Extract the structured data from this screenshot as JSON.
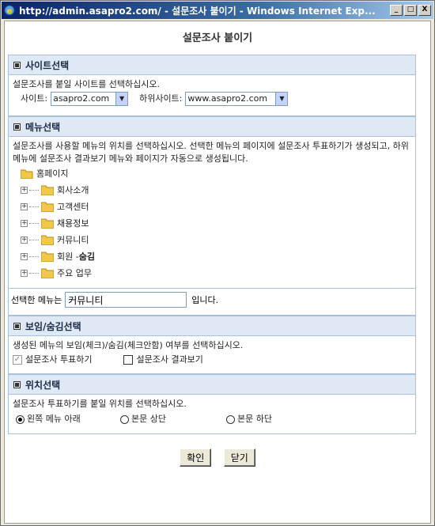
{
  "window": {
    "title": "http://admin.asapro2.com/ - 설문조사 붙이기 - Windows Internet Exp...",
    "minimize": "_",
    "maximize": "□",
    "close": "X"
  },
  "page": {
    "title": "설문조사 붙이기"
  },
  "site_section": {
    "header": "사이트선택",
    "desc": "설문조사를 붙일 사이트를 선택하십시오.",
    "site_label": "사이트:",
    "site_value": "asapro2.com",
    "subsite_label": "하위사이트:",
    "subsite_value": "www.asapro2.com"
  },
  "menu_section": {
    "header": "메뉴선택",
    "desc": "설문조사를 사용할 메뉴의 위치를 선택하십시오. 선택한 메뉴의 페이지에 설문조사 투표하기가 생성되고, 하위 메뉴에 설문조사 결과보기 메뉴와 페이지가 자동으로 생성됩니다.",
    "root": "홈페이지",
    "items": [
      {
        "label": "회사소개",
        "suffix": ""
      },
      {
        "label": "고객센터",
        "suffix": ""
      },
      {
        "label": "채용정보",
        "suffix": ""
      },
      {
        "label": "커뮤니티",
        "suffix": ""
      },
      {
        "label": "회원 - ",
        "suffix": "숨김"
      },
      {
        "label": "주요 업무",
        "suffix": ""
      }
    ],
    "selected_prefix": "선택한 메뉴는",
    "selected_value": "커뮤니티",
    "selected_suffix": "입니다."
  },
  "visibility_section": {
    "header": "보임/숨김선택",
    "desc": "생성된 메뉴의 보임(체크)/숨김(체크안함) 여부를 선택하십시오.",
    "vote_label": "설문조사 투표하기",
    "vote_checked": true,
    "result_label": "설문조사 결과보기",
    "result_checked": false
  },
  "position_section": {
    "header": "위치선택",
    "desc": "설문조사 투표하기를 붙일 위치를 선택하십시오.",
    "options": [
      "왼쪽 메뉴 아래",
      "본문 상단",
      "본문 하단"
    ],
    "selected_index": 0
  },
  "buttons": {
    "confirm": "확인",
    "close": "닫기"
  },
  "colors": {
    "section_bg": "#dfe9f5",
    "section_border": "#a8c0dc",
    "folder": "#f2c84b"
  }
}
